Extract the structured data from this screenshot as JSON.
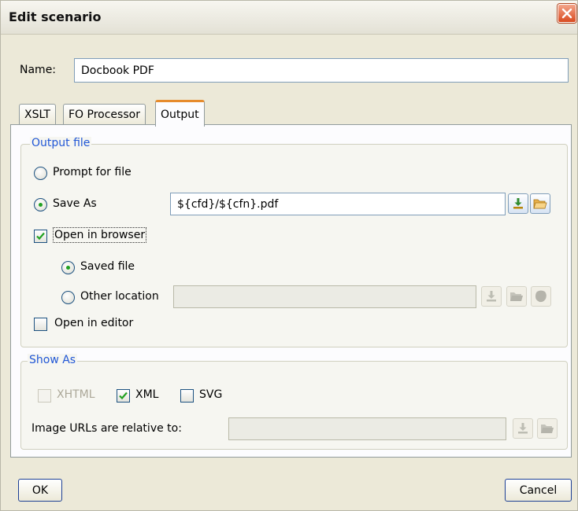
{
  "window": {
    "title": "Edit scenario"
  },
  "name_field": {
    "label": "Name:",
    "value": "Docbook PDF"
  },
  "tabs": [
    {
      "label": "XSLT",
      "active": false
    },
    {
      "label": "FO Processor",
      "active": false
    },
    {
      "label": "Output",
      "active": true
    }
  ],
  "output_file": {
    "group_title": "Output file",
    "prompt_label": "Prompt for file",
    "save_as_label": "Save As",
    "save_as_value": "${cfd}/${cfn}.pdf",
    "open_in_browser_label": "Open in browser",
    "saved_file_label": "Saved file",
    "other_location_label": "Other location",
    "other_location_value": "",
    "open_in_editor_label": "Open in editor",
    "selected": "save_as",
    "open_in_browser_checked": true,
    "browser_target": "saved_file",
    "open_in_editor_checked": false
  },
  "show_as": {
    "group_title": "Show As",
    "xhtml_label": "XHTML",
    "xml_label": "XML",
    "svg_label": "SVG",
    "xhtml_checked": false,
    "xhtml_enabled": false,
    "xml_checked": true,
    "svg_checked": false,
    "image_urls_label": "Image URLs are relative to:",
    "image_urls_value": ""
  },
  "buttons": {
    "ok": "OK",
    "cancel": "Cancel"
  },
  "colors": {
    "accent": "#2157d6",
    "tab_highlight": "#e68b2c",
    "check": "#21a121",
    "close": "#d94b21"
  },
  "icons": [
    "close-icon",
    "insert-editor-variables-icon",
    "browse-folder-icon",
    "browse-url-icon"
  ]
}
